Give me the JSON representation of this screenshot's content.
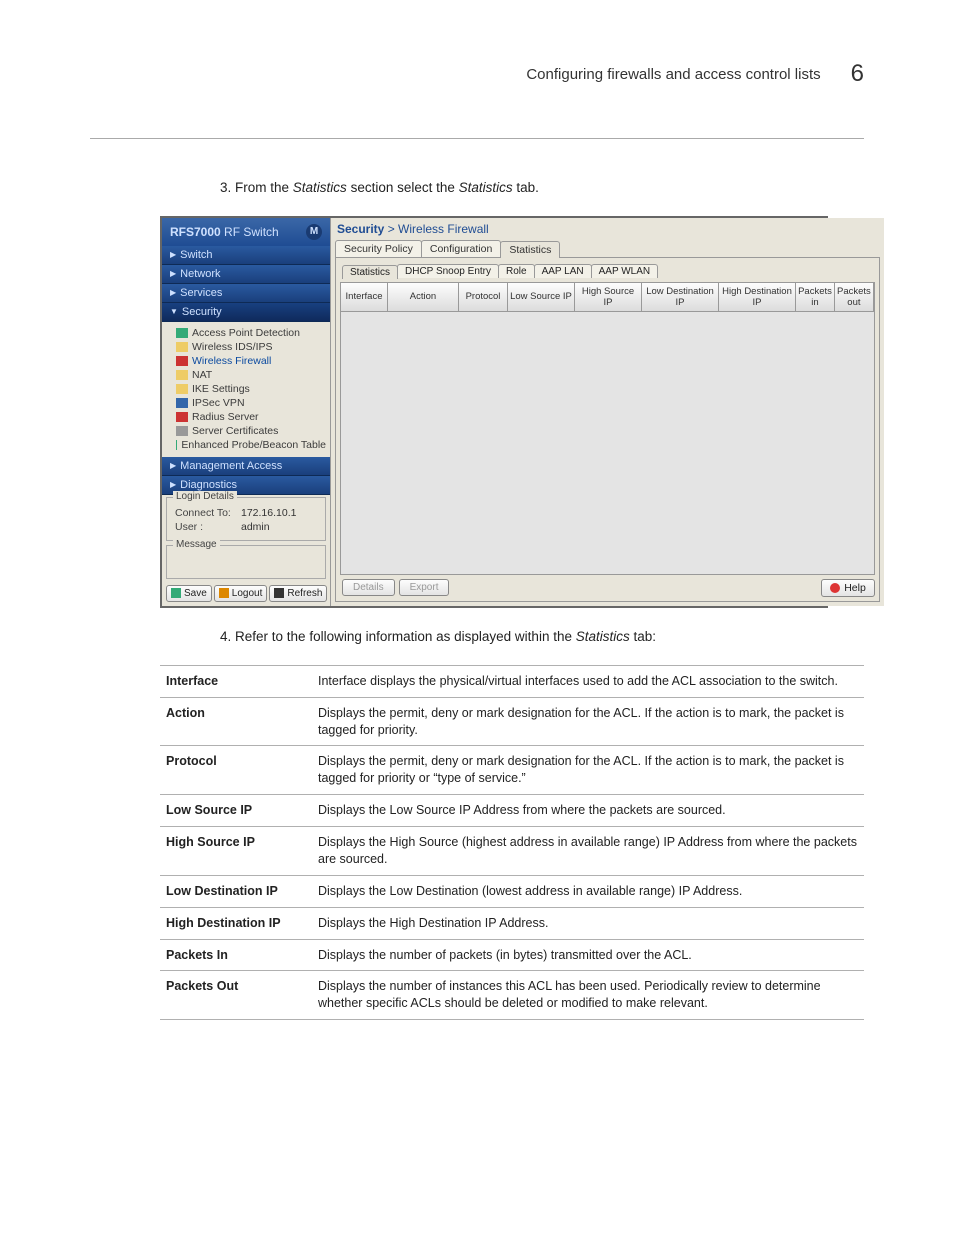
{
  "header": {
    "title": "Configuring firewalls and access control lists",
    "chapter": "6"
  },
  "steps": {
    "s3_num": "3.",
    "s3_before": "From the ",
    "s3_i1": "Statistics",
    "s3_mid": " section select the ",
    "s3_i2": "Statistics",
    "s3_after": " tab.",
    "s4_num": "4.",
    "s4_before": "Refer to the following information as displayed within the ",
    "s4_i1": "Statistics",
    "s4_after": " tab:"
  },
  "screenshot": {
    "product_a": "RFS7000",
    "product_b": " RF Switch",
    "logo": "M",
    "nav": {
      "switch": "Switch",
      "network": "Network",
      "services": "Services",
      "security": "Security",
      "mgmt": "Management Access",
      "diag": "Diagnostics"
    },
    "tree": {
      "apd": "Access Point Detection",
      "ids": "Wireless IDS/IPS",
      "wf": "Wireless Firewall",
      "nat": "NAT",
      "ike": "IKE Settings",
      "ipsec": "IPSec VPN",
      "radius": "Radius Server",
      "certs": "Server Certificates",
      "probe": "Enhanced Probe/Beacon Table"
    },
    "login": {
      "legend": "Login Details",
      "connect_k": "Connect To:",
      "connect_v": "172.16.10.1",
      "user_k": "User :",
      "user_v": "admin"
    },
    "message_legend": "Message",
    "btns": {
      "save": "Save",
      "logout": "Logout",
      "refresh": "Refresh"
    },
    "crumb_a": "Security",
    "crumb_sep": " > ",
    "crumb_b": "Wireless Firewall",
    "tabs": {
      "sp": "Security Policy",
      "cfg": "Configuration",
      "stats": "Statistics"
    },
    "subtabs": {
      "stats": "Statistics",
      "dhcp": "DHCP Snoop Entry",
      "role": "Role",
      "aaplan": "AAP LAN",
      "aapwlan": "AAP WLAN"
    },
    "columns": {
      "iface": "Interface",
      "action": "Action",
      "protocol": "Protocol",
      "lowsrc": "Low Source IP",
      "highsrc": "High Source IP",
      "lowdst": "Low Destination IP",
      "highdst": "High Destination IP",
      "pin": "Packets in",
      "pout": "Packets out"
    },
    "footer": {
      "details": "Details",
      "export": "Export",
      "help": "Help"
    }
  },
  "table": [
    {
      "term": "Interface",
      "desc": "Interface displays the physical/virtual interfaces used to add the ACL association to the switch."
    },
    {
      "term": "Action",
      "desc": "Displays the permit, deny or mark designation for the ACL. If the action is to mark, the packet is tagged for priority."
    },
    {
      "term": "Protocol",
      "desc": "Displays the permit, deny or mark designation for the ACL. If the action is to mark, the packet is tagged for priority or “type of service.”"
    },
    {
      "term": "Low Source IP",
      "desc": "Displays the Low Source IP Address from where the packets are sourced."
    },
    {
      "term": "High Source IP",
      "desc": "Displays the High Source (highest address in available range) IP Address from where the packets are sourced."
    },
    {
      "term": "Low Destination IP",
      "desc": "Displays the Low Destination (lowest address in available range) IP Address."
    },
    {
      "term": "High Destination IP",
      "desc": "Displays the High Destination IP Address."
    },
    {
      "term": "Packets In",
      "desc": "Displays the number of packets (in bytes) transmitted over the ACL."
    },
    {
      "term": "Packets Out",
      "desc": "Displays the number of instances this ACL has been used. Periodically review to determine whether specific ACLs should be deleted or modified to make relevant."
    }
  ]
}
